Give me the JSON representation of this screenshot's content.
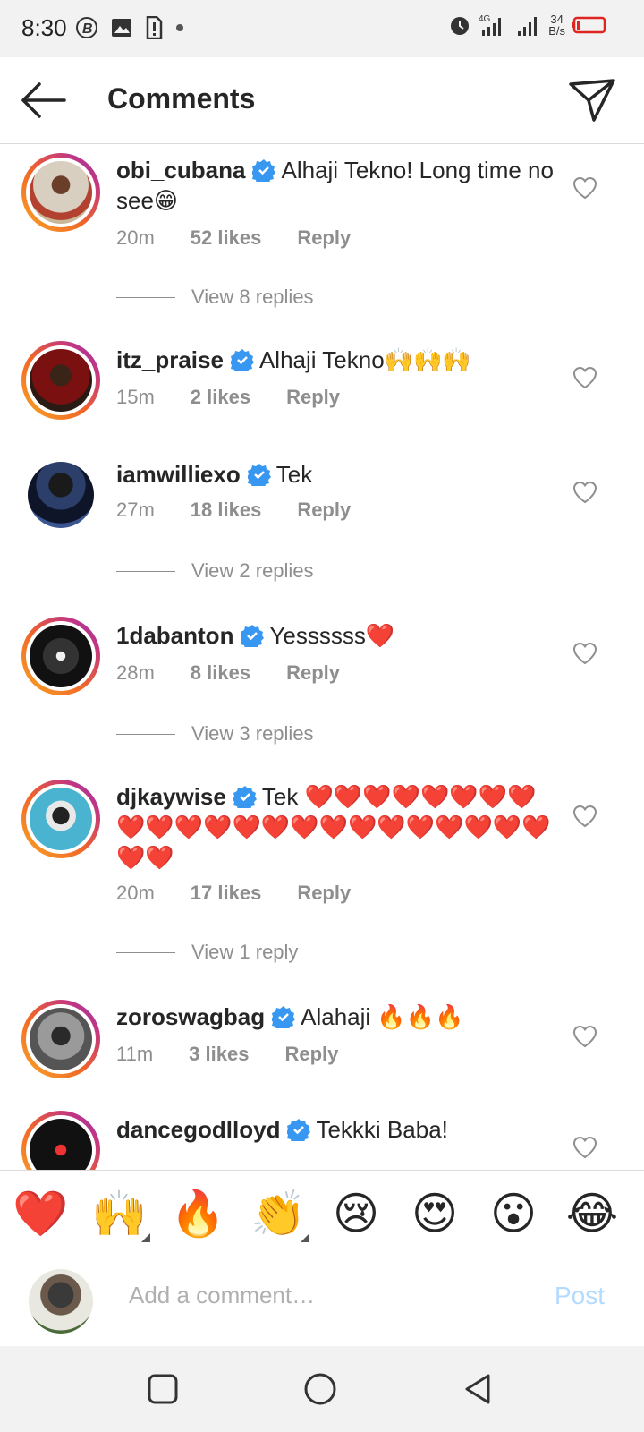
{
  "status_bar": {
    "time": "8:30",
    "speed_value": "34",
    "speed_unit": "B/s",
    "left_icons": [
      "b-icon",
      "image-icon",
      "sim-alert-icon",
      "dot-icon"
    ],
    "right_icons": [
      "alarm-icon",
      "signal-4g-icon",
      "signal-icon",
      "battery-low-icon"
    ]
  },
  "header": {
    "title": "Comments",
    "back_icon": "arrow-left-icon",
    "share_icon": "send-icon"
  },
  "comments": [
    {
      "username": "obi_cubana",
      "verified": true,
      "text": "Alhaji Tekno! Long time no see😁",
      "time": "20m",
      "likes": "52 likes",
      "reply_label": "Reply",
      "view_replies": "View 8 replies",
      "has_story_ring": true
    },
    {
      "username": "itz_praise",
      "verified": true,
      "text": "Alhaji Tekno🙌🙌🙌",
      "time": "15m",
      "likes": "2 likes",
      "reply_label": "Reply",
      "view_replies": "",
      "has_story_ring": true
    },
    {
      "username": "iamwilliexo",
      "verified": true,
      "text": "Tek",
      "time": "27m",
      "likes": "18 likes",
      "reply_label": "Reply",
      "view_replies": "View 2 replies",
      "has_story_ring": false
    },
    {
      "username": "1dabanton",
      "verified": true,
      "text": "Yessssss❤️",
      "time": "28m",
      "likes": "8 likes",
      "reply_label": "Reply",
      "view_replies": "View 3 replies",
      "has_story_ring": true
    },
    {
      "username": "djkaywise",
      "verified": true,
      "text": "Tek ❤️❤️❤️❤️❤️❤️❤️❤️❤️❤️❤️❤️❤️❤️❤️❤️❤️❤️❤️❤️❤️❤️❤️❤️❤️",
      "time": "20m",
      "likes": "17 likes",
      "reply_label": "Reply",
      "view_replies": "View 1 reply",
      "has_story_ring": true
    },
    {
      "username": "zoroswagbag",
      "verified": true,
      "text": "Alahaji 🔥🔥🔥",
      "time": "11m",
      "likes": "3 likes",
      "reply_label": "Reply",
      "view_replies": "",
      "has_story_ring": true
    },
    {
      "username": "dancegodlloyd",
      "verified": true,
      "text": "Tekkki Baba!",
      "time": "",
      "likes": "",
      "reply_label": "",
      "view_replies": "",
      "has_story_ring": true
    }
  ],
  "emoji_bar": {
    "emojis": [
      "❤️",
      "🙌",
      "🔥",
      "👏",
      "😢",
      "😍",
      "😮",
      "😂"
    ]
  },
  "composer": {
    "placeholder": "Add a comment…",
    "post_label": "Post"
  },
  "nav_bar": {
    "buttons": [
      "recents-square-icon",
      "home-circle-icon",
      "back-triangle-icon"
    ]
  },
  "colors": {
    "accent_blue": "#3897f0",
    "post_disabled": "#b3dbff",
    "text_primary": "#262626",
    "text_secondary": "#8e8e8e",
    "heart_red": "#e0241f"
  }
}
